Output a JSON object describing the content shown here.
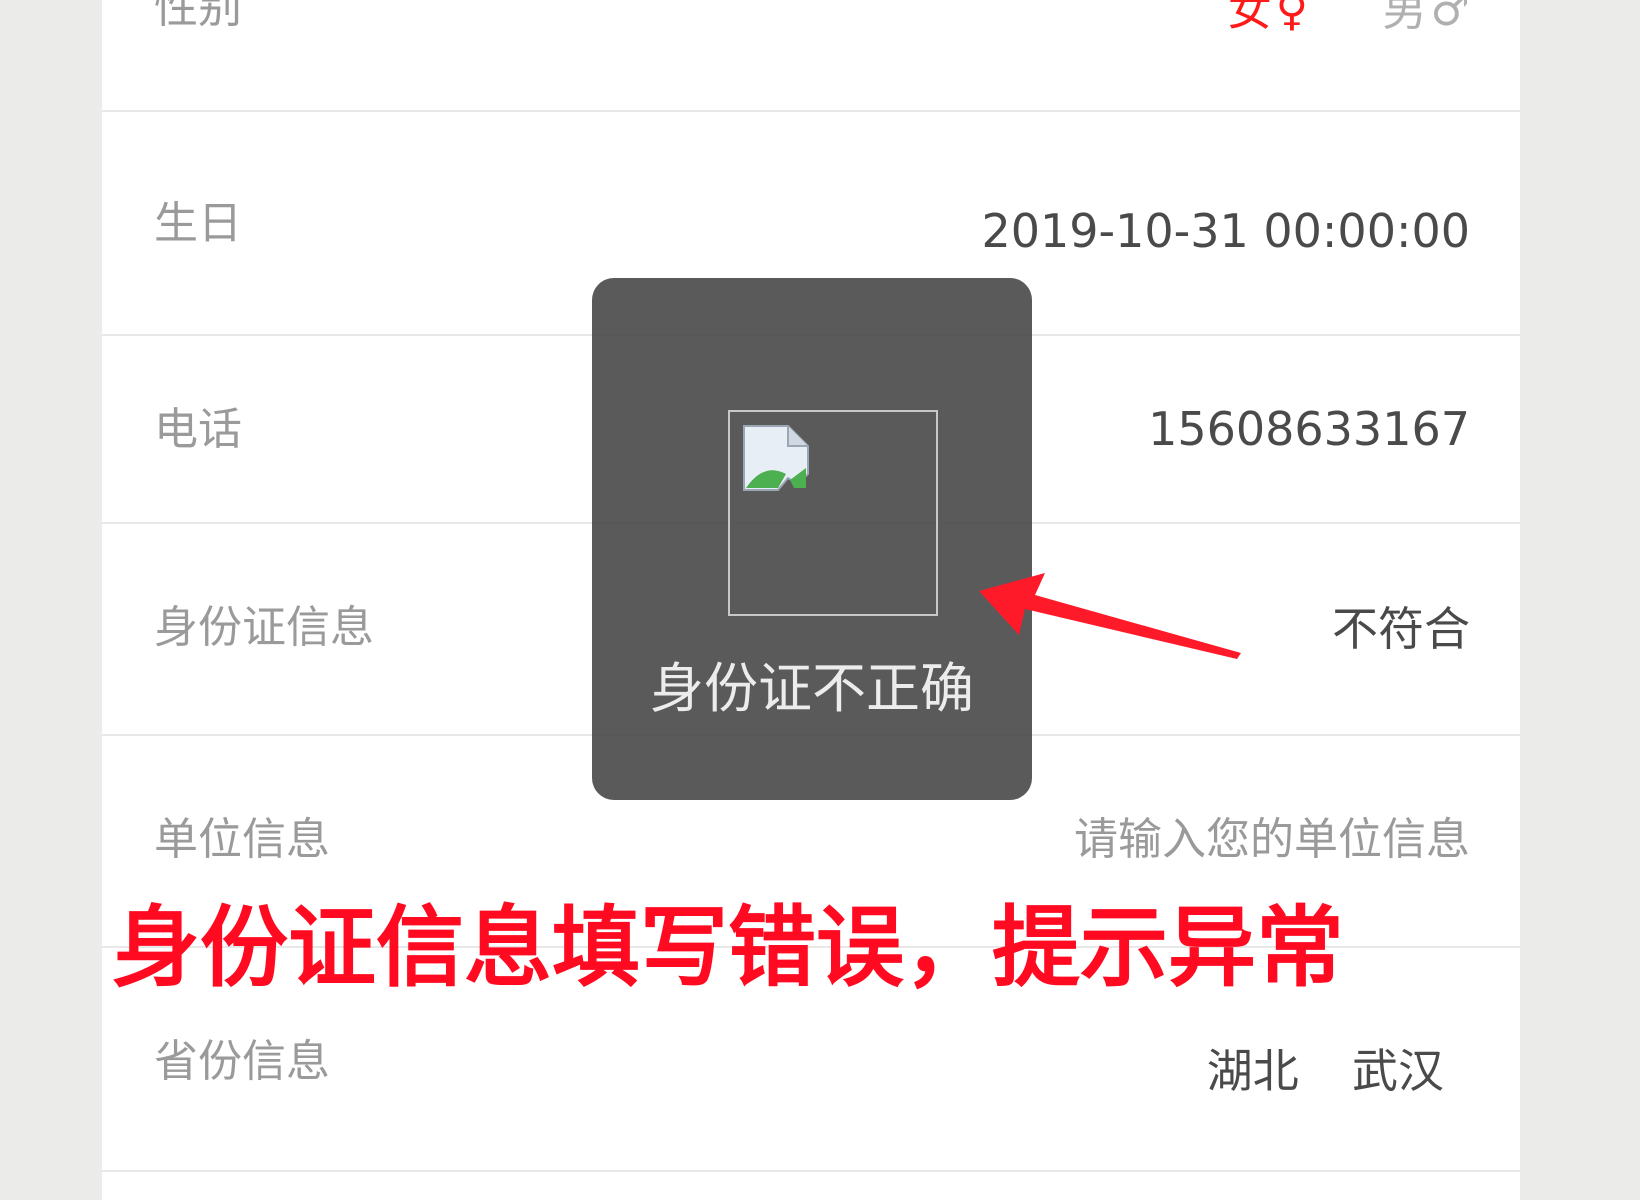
{
  "form": {
    "gender": {
      "label": "性别",
      "female": "女",
      "female_symbol": "♀",
      "male": "男",
      "male_symbol": "♂",
      "selected": "female"
    },
    "birthday": {
      "label": "生日",
      "value": "2019-10-31 00:00:00"
    },
    "phone": {
      "label": "电话",
      "value": "15608633167"
    },
    "id_card": {
      "label": "身份证信息",
      "value": "不符合"
    },
    "work_unit": {
      "label": "单位信息",
      "placeholder": "请输入您的单位信息"
    },
    "province": {
      "label": "省份信息",
      "province_value": "湖北",
      "city_value": "武汉"
    }
  },
  "toast": {
    "icon": "broken-image-icon",
    "message": "身份证不正确"
  },
  "annotation": {
    "text": "身份证信息填写错误，提示异常",
    "color": "#ff0a20"
  },
  "colors": {
    "selected_gender": "#ff1a1a",
    "toast_bg": "#484848"
  }
}
